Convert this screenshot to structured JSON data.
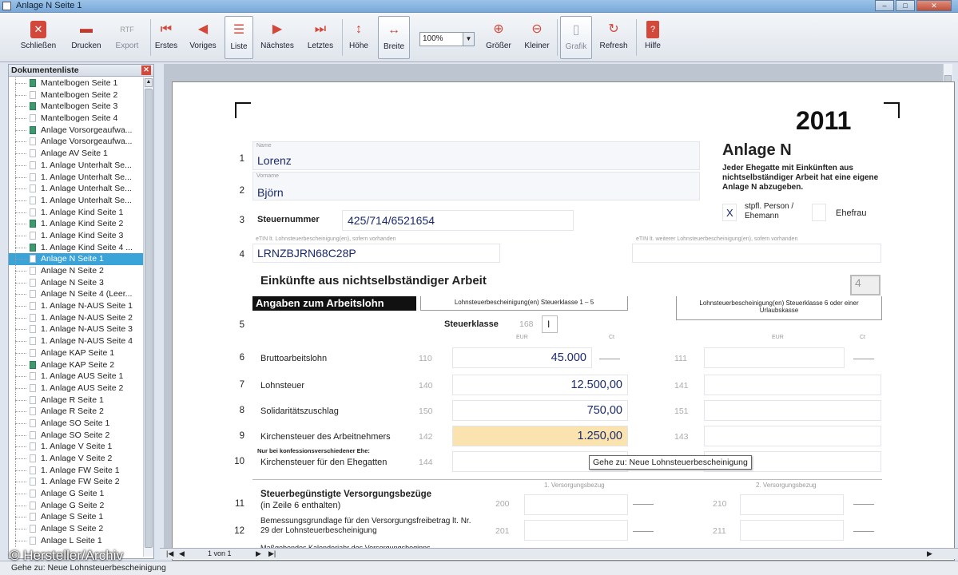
{
  "window": {
    "title": "Anlage N  Seite 1"
  },
  "toolbar": {
    "items": [
      {
        "label": "Schließen",
        "icon": "close-icon"
      },
      {
        "label": "Drucken",
        "icon": "print-icon"
      },
      {
        "label": "Export",
        "icon": "export-icon"
      },
      {
        "label": "Erstes",
        "icon": "first-icon"
      },
      {
        "label": "Voriges",
        "icon": "prev-icon"
      },
      {
        "label": "Liste",
        "icon": "list-icon"
      },
      {
        "label": "Nächstes",
        "icon": "next-icon"
      },
      {
        "label": "Letztes",
        "icon": "last-icon"
      },
      {
        "label": "Höhe",
        "icon": "fit-height-icon"
      },
      {
        "label": "Breite",
        "icon": "fit-width-icon"
      },
      {
        "label": "Größer",
        "icon": "zoom-in-icon"
      },
      {
        "label": "Kleiner",
        "icon": "zoom-out-icon"
      },
      {
        "label": "Grafik",
        "icon": "graphic-icon"
      },
      {
        "label": "Refresh",
        "icon": "refresh-icon"
      },
      {
        "label": "Hilfe",
        "icon": "help-icon"
      }
    ],
    "zoom": "100%",
    "export_tag": "RTF"
  },
  "sidebar": {
    "title": "Dokumentenliste",
    "items": [
      "Mantelbogen Seite 1",
      "Mantelbogen Seite 2",
      "Mantelbogen Seite 3",
      "Mantelbogen Seite 4",
      "Anlage Vorsorgeaufwa...",
      "Anlage Vorsorgeaufwa...",
      "Anlage AV Seite 1",
      "1. Anlage Unterhalt  Se...",
      "1. Anlage Unterhalt  Se...",
      "1. Anlage Unterhalt  Se...",
      "1. Anlage Unterhalt  Se...",
      "1. Anlage Kind Seite 1",
      "1. Anlage Kind Seite 2",
      "1. Anlage Kind Seite 3",
      "1. Anlage Kind Seite 4 ...",
      "Anlage N  Seite 1",
      "Anlage N  Seite 2",
      "Anlage N  Seite 3",
      "Anlage N  Seite 4 (Leer...",
      "1. Anlage N-AUS  Seite 1",
      "1. Anlage N-AUS  Seite 2",
      "1. Anlage N-AUS  Seite 3",
      "1. Anlage N-AUS  Seite 4",
      "Anlage KAP  Seite 1",
      "Anlage KAP  Seite 2",
      "1. Anlage AUS  Seite 1",
      "1. Anlage AUS  Seite 2",
      "Anlage R  Seite 1",
      "Anlage R  Seite 2",
      "Anlage SO  Seite 1",
      "Anlage SO  Seite 2",
      "1. Anlage V  Seite 1",
      "1. Anlage V  Seite 2",
      "1. Anlage FW  Seite 1",
      "1. Anlage FW  Seite 2",
      "Anlage G  Seite 1",
      "Anlage G  Seite 2",
      "Anlage S  Seite 1",
      "Anlage S  Seite 2",
      "Anlage L Seite 1"
    ],
    "selected_index": 15
  },
  "form": {
    "year": "2011",
    "title": "Anlage N",
    "subtitle": "Jeder Ehegatte mit Einkünften aus nichtselbständiger Arbeit hat eine eigene Anlage N abzugeben.",
    "name_label": "Name",
    "name": "Lorenz",
    "vorname_label": "Vorname",
    "vorname": "Björn",
    "steuernummer_label": "Steuernummer",
    "steuernummer": "425/714/6521654",
    "person_x": "X",
    "person_label": "stpfl. Person / Ehemann",
    "ehefrau_label": "Ehefrau",
    "etin_label": "eTIN lt. Lohnsteuerbescheinigung(en), sofern vorhanden",
    "etin2_label": "eTIN lt. weiterer Lohnsteuerbescheinigung(en), sofern vorhanden",
    "etin": "LRNZBJRN68C28P",
    "section_title": "Einkünfte aus nichtselbständiger Arbeit",
    "section_box": "4",
    "angaben": "Angaben zum Arbeitslohn",
    "col1": "Lohnsteuerbescheinigung(en) Steuerklasse 1 – 5",
    "col2": "Lohnsteuerbescheinigung(en) Steuerklasse 6 oder einer Urlaubskasse",
    "steuerklasse_label": "Steuerklasse",
    "steuerklasse_kz": "168",
    "steuerklasse": "I",
    "eur": "EUR",
    "ct": "Ct",
    "rows": [
      {
        "nr": "6",
        "label": "Bruttoarbeitslohn",
        "kz": "110",
        "value": "45.000",
        "kz2": "111"
      },
      {
        "nr": "7",
        "label": "Lohnsteuer",
        "kz": "140",
        "value": "12.500,00",
        "kz2": "141"
      },
      {
        "nr": "8",
        "label": "Solidaritätszuschlag",
        "kz": "150",
        "value": "750,00",
        "kz2": "151"
      },
      {
        "nr": "9",
        "label": "Kirchensteuer des Arbeitnehmers",
        "kz": "142",
        "value": "1.250,00",
        "kz2": "143"
      },
      {
        "nr": "10",
        "label": "Kirchensteuer für den Ehegatten",
        "kz": "144",
        "value": "",
        "kz2": ""
      }
    ],
    "row10_note": "Nur bei konfessionsverschiedener Ehe:",
    "tooltip": "Gehe zu: Neue Lohnsteuerbescheinigung",
    "vb_title": "Steuerbegünstigte Versorgungsbezüge",
    "vb_sub": "(in Zeile 6 enthalten)",
    "vb1": "1. Versorgungsbezug",
    "vb2": "2. Versorgungsbezug",
    "row11_kz": "200",
    "row11_kz2": "210",
    "row12_label": "Bemessungsgrundlage für den Versorgungsfreibetrag lt. Nr. 29 der Lohnsteuerbescheinigung",
    "row12_kz": "201",
    "row12_kz2": "211",
    "row13_label": "Maßgebendes Kalenderjahr des Versorgungsbeginns",
    "row_numbers": {
      "r1": "1",
      "r2": "2",
      "r3": "3",
      "r4": "4",
      "r5": "5",
      "r11": "11",
      "r12": "12"
    }
  },
  "bottom": {
    "page_info": "1 von 1"
  },
  "status": {
    "text": "Gehe zu: Neue Lohnsteuerbescheinigung"
  },
  "watermark": "© Hersteller/Archiv"
}
